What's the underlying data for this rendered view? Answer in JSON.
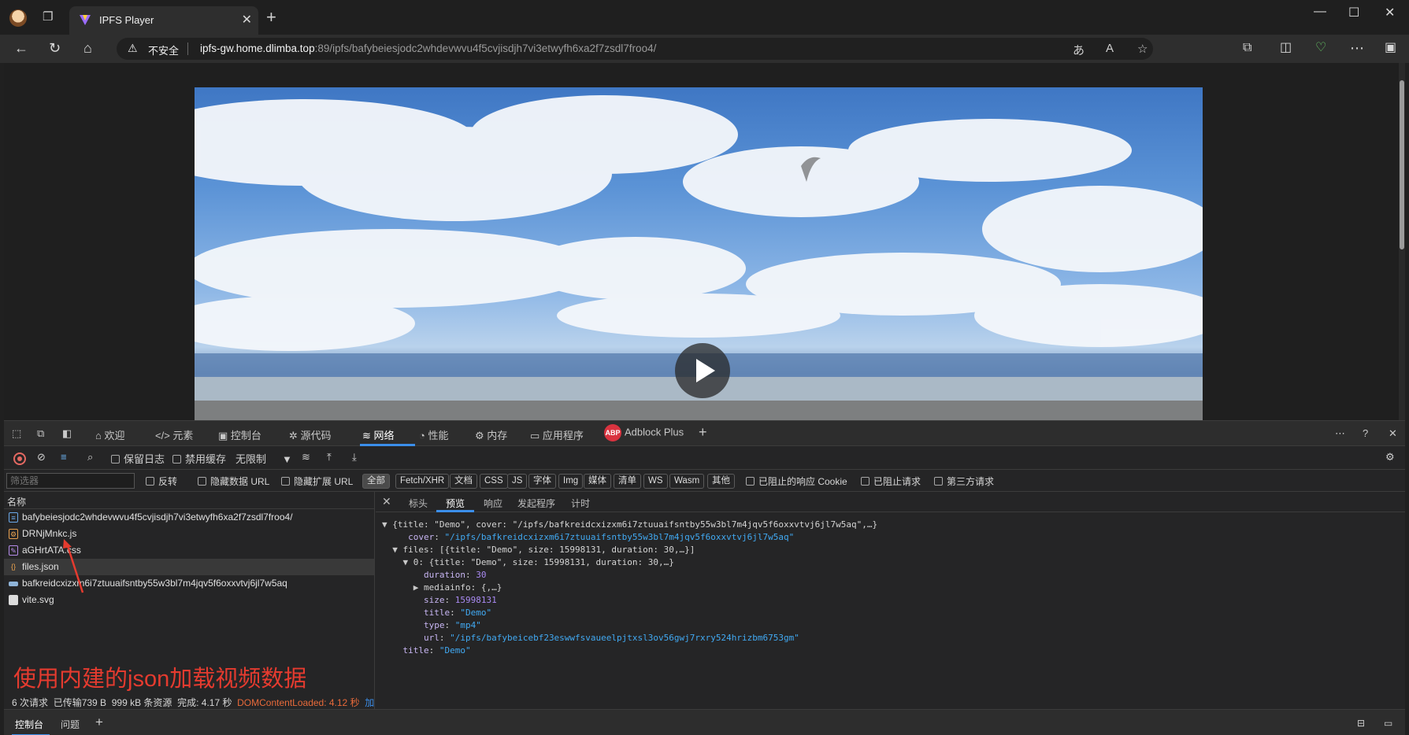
{
  "browser": {
    "tab_title": "IPFS Player",
    "security_label": "不安全",
    "url_host": "ipfs-gw.home.dlimba.top",
    "url_rest": ":89/ipfs/bafybeiesjodc2whdevwvu4f5cvjisdjh7vi3etwyfh6xa2f7zsdl7froo4/"
  },
  "devtools": {
    "tabs": [
      "欢迎",
      "元素",
      "控制台",
      "源代码",
      "网络",
      "性能",
      "内存",
      "应用程序",
      "Adblock Plus"
    ],
    "active_tab": "网络",
    "toolbar": {
      "preserve_log": "保留日志",
      "disable_cache": "禁用缓存",
      "throttle": "无限制"
    },
    "filter": {
      "placeholder": "筛选器",
      "invert": "反转",
      "hide_data_urls": "隐藏数据 URL",
      "hide_ext_urls": "隐藏扩展 URL",
      "types": [
        "全部",
        "Fetch/XHR",
        "文档",
        "CSS",
        "JS",
        "字体",
        "Img",
        "媒体",
        "清单",
        "WS",
        "Wasm",
        "其他"
      ],
      "blocked_cookies": "已阻止的响应 Cookie",
      "blocked_requests": "已阻止请求",
      "third_party": "第三方请求"
    },
    "requests": {
      "header": "名称",
      "rows": [
        {
          "name": "bafybeiesjodc2whdevwvu4f5cvjisdjh7vi3etwyfh6xa2f7zsdl7froo4/",
          "icon": "document-icon"
        },
        {
          "name": "DRNjMnkc.js",
          "icon": "script-icon"
        },
        {
          "name": "aGHrtATA.css",
          "icon": "stylesheet-icon"
        },
        {
          "name": "files.json",
          "icon": "json-icon"
        },
        {
          "name": "bafkreidcxizxm6i7ztuuaifsntby55w3bl7m4jqv5f6oxxvtvj6jl7w5aq",
          "icon": "image-icon"
        },
        {
          "name": "vite.svg",
          "icon": "file-icon"
        }
      ],
      "selected_index": 3
    },
    "status": {
      "requests": "6 次请求",
      "transferred": "已传输739 B",
      "resources": "999 kB 条资源",
      "finish": "完成: 4.17 秒",
      "dcl": "DOMContentLoaded: 4.12 秒",
      "extra": "加"
    },
    "detail_tabs": [
      "标头",
      "预览",
      "响应",
      "发起程序",
      "计时"
    ],
    "active_detail_tab": "预览",
    "preview": {
      "root": "{title: \"Demo\", cover: \"/ipfs/bafkreidcxizxm6i7ztuuaifsntby55w3bl7m4jqv5f6oxxvtvj6jl7w5aq\",…}",
      "cover_key": "cover",
      "cover_val": "\"/ipfs/bafkreidcxizxm6i7ztuuaifsntby55w3bl7m4jqv5f6oxxvtvj6jl7w5aq\"",
      "files_line": "files: [{title: \"Demo\", size: 15998131, duration: 30,…}]",
      "item_line": "0: {title: \"Demo\", size: 15998131, duration: 30,…}",
      "duration_key": "duration",
      "duration_val": "30",
      "mediainfo_line": "mediainfo: {,…}",
      "size_key": "size",
      "size_val": "15998131",
      "title_key": "title",
      "title_val": "\"Demo\"",
      "type_key": "type",
      "type_val": "\"mp4\"",
      "url_key": "url",
      "url_val": "\"/ipfs/bafybeicebf23eswwfsvaueelpjtxsl3ov56gwj7rxry524hrizbm6753gm\"",
      "root_title_key": "title",
      "root_title_val": "\"Demo\""
    },
    "drawer_tabs": [
      "控制台",
      "问题"
    ]
  },
  "annotation": "使用内建的json加载视频数据",
  "colors": {
    "accent": "#3b8eea",
    "annotation": "#e53b2f",
    "json_string": "#41a9f2",
    "json_number": "#a98af2"
  }
}
